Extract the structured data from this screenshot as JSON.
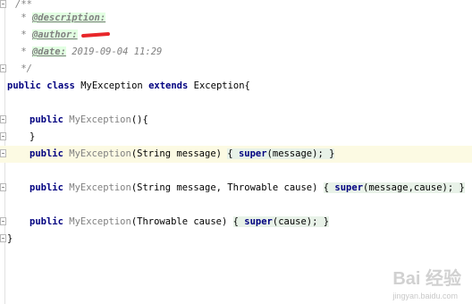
{
  "editor": {
    "lines": {
      "l1": "/**",
      "l2_prefix": " * ",
      "l2_tag": "@description:",
      "l3_prefix": " * ",
      "l3_tag": "@author:",
      "l4_prefix": " * ",
      "l4_tag": "@date:",
      "l4_value": " 2019-09-04 11:29",
      "l5": " */",
      "class_kw1": "public",
      "class_kw2": "class",
      "class_name": "MyException",
      "class_kw3": "extends",
      "class_rest": " Exception{",
      "m1_kw": "public",
      "m1_name": "MyException",
      "m1_rest": "(){",
      "m1_close": "}",
      "m2_kw": "public",
      "m2_name": "MyException",
      "m2_params": "(String message) ",
      "m2_body_open": "{ ",
      "m2_super": "super",
      "m2_body_rest": "(message); }",
      "m3_kw": "public",
      "m3_name": "MyException",
      "m3_params": "(String message, Throwable cause) ",
      "m3_body_open": "{ ",
      "m3_super": "super",
      "m3_body_rest": "(message,cause); }",
      "m4_kw": "public",
      "m4_name": "MyException",
      "m4_params": "(Throwable cause) ",
      "m4_body_open": "{ ",
      "m4_super": "super",
      "m4_body_rest": "(cause); }",
      "class_close": "}"
    }
  },
  "watermark": {
    "text": "Bai 经验",
    "sub": "jingyan.baidu.com"
  }
}
